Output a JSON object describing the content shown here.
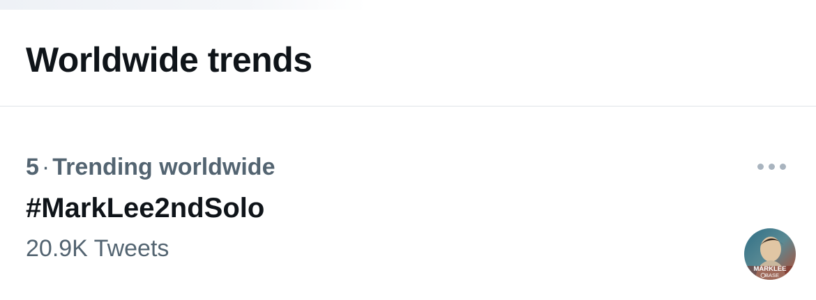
{
  "header": {
    "title": "Worldwide trends"
  },
  "trend": {
    "rank": "5",
    "separator": "·",
    "context": "Trending worldwide",
    "name": "#MarkLee2ndSolo",
    "count": "20.9K Tweets",
    "more_icon": "more-horizontal-icon",
    "avatar": {
      "line1": "MARKLEE",
      "line2": "BASE"
    }
  },
  "colors": {
    "primary_text": "#0f1419",
    "secondary_text": "#536471",
    "divider": "#dfe3e7",
    "more_dots": "#a9b4bf",
    "avatar_accent": "#c0392b"
  }
}
